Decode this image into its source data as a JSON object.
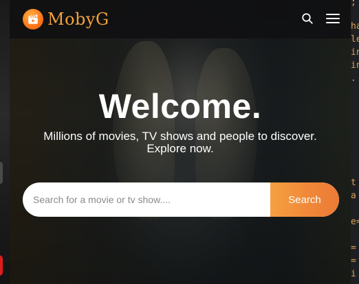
{
  "app": {
    "brand_name": "MobyG",
    "brand_color": "#f3a33c"
  },
  "navbar": {
    "search_icon": "search-icon",
    "menu_icon": "hamburger-menu-icon"
  },
  "hero": {
    "title": "Welcome.",
    "subtitle_line1": "Millions of movies, TV shows and people to discover.",
    "subtitle_line2": "Explore now."
  },
  "search": {
    "placeholder": "Search for a movie or tv show....",
    "value": "",
    "button_label": "Search",
    "button_color": "#f08a3a"
  },
  "background_editor": {
    "code_lines": [
      {
        "text": ";"
      },
      {
        "text": "ha"
      },
      {
        "text": "le"
      },
      {
        "text": "in"
      },
      {
        "text": "in"
      },
      {
        "text": "."
      },
      {
        "text": "t"
      },
      {
        "text": "a"
      },
      {
        "text": "e="
      },
      {
        "text": "="
      },
      {
        "text": "="
      },
      {
        "text": "i"
      }
    ]
  }
}
